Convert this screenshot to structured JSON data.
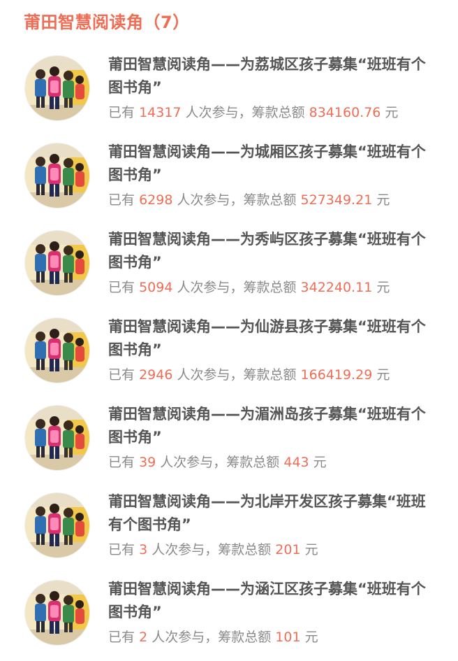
{
  "header": {
    "title": "莆田智慧阅读角（7）"
  },
  "items": [
    {
      "title": "莆田智慧阅读角——为荔城区孩子募集“班班有个图书角”",
      "prefix": "已有",
      "count": "14317",
      "mid": "人次参与，筹款总额",
      "amount": "834160.76",
      "unit": "元"
    },
    {
      "title": "莆田智慧阅读角——为城厢区孩子募集“班班有个图书角”",
      "prefix": "已有",
      "count": "6298",
      "mid": "人次参与，筹款总额",
      "amount": "527349.21",
      "unit": "元"
    },
    {
      "title": "莆田智慧阅读角——为秀屿区孩子募集“班班有个图书角”",
      "prefix": "已有",
      "count": "5094",
      "mid": "人次参与，筹款总额",
      "amount": "342240.11",
      "unit": "元"
    },
    {
      "title": "莆田智慧阅读角——为仙游县孩子募集“班班有个图书角”",
      "prefix": "已有",
      "count": "2946",
      "mid": "人次参与，筹款总额",
      "amount": "166419.29",
      "unit": "元"
    },
    {
      "title": "莆田智慧阅读角——为湄洲岛孩子募集“班班有个图书角”",
      "prefix": "已有",
      "count": "39",
      "mid": "人次参与，筹款总额",
      "amount": "443",
      "unit": "元"
    },
    {
      "title": "莆田智慧阅读角——为北岸开发区孩子募集“班班有个图书角”",
      "prefix": "已有",
      "count": "3",
      "mid": "人次参与，筹款总额",
      "amount": "201",
      "unit": "元"
    },
    {
      "title": "莆田智慧阅读角——为涵江区孩子募集“班班有个图书角”",
      "prefix": "已有",
      "count": "2",
      "mid": "人次参与，筹款总额",
      "amount": "101",
      "unit": "元"
    }
  ],
  "colors": {
    "accent": "#ef6d55",
    "title_text": "#555555",
    "muted_text": "#8a8a8a"
  },
  "icons": {
    "avatar": "children-photo-avatar"
  }
}
